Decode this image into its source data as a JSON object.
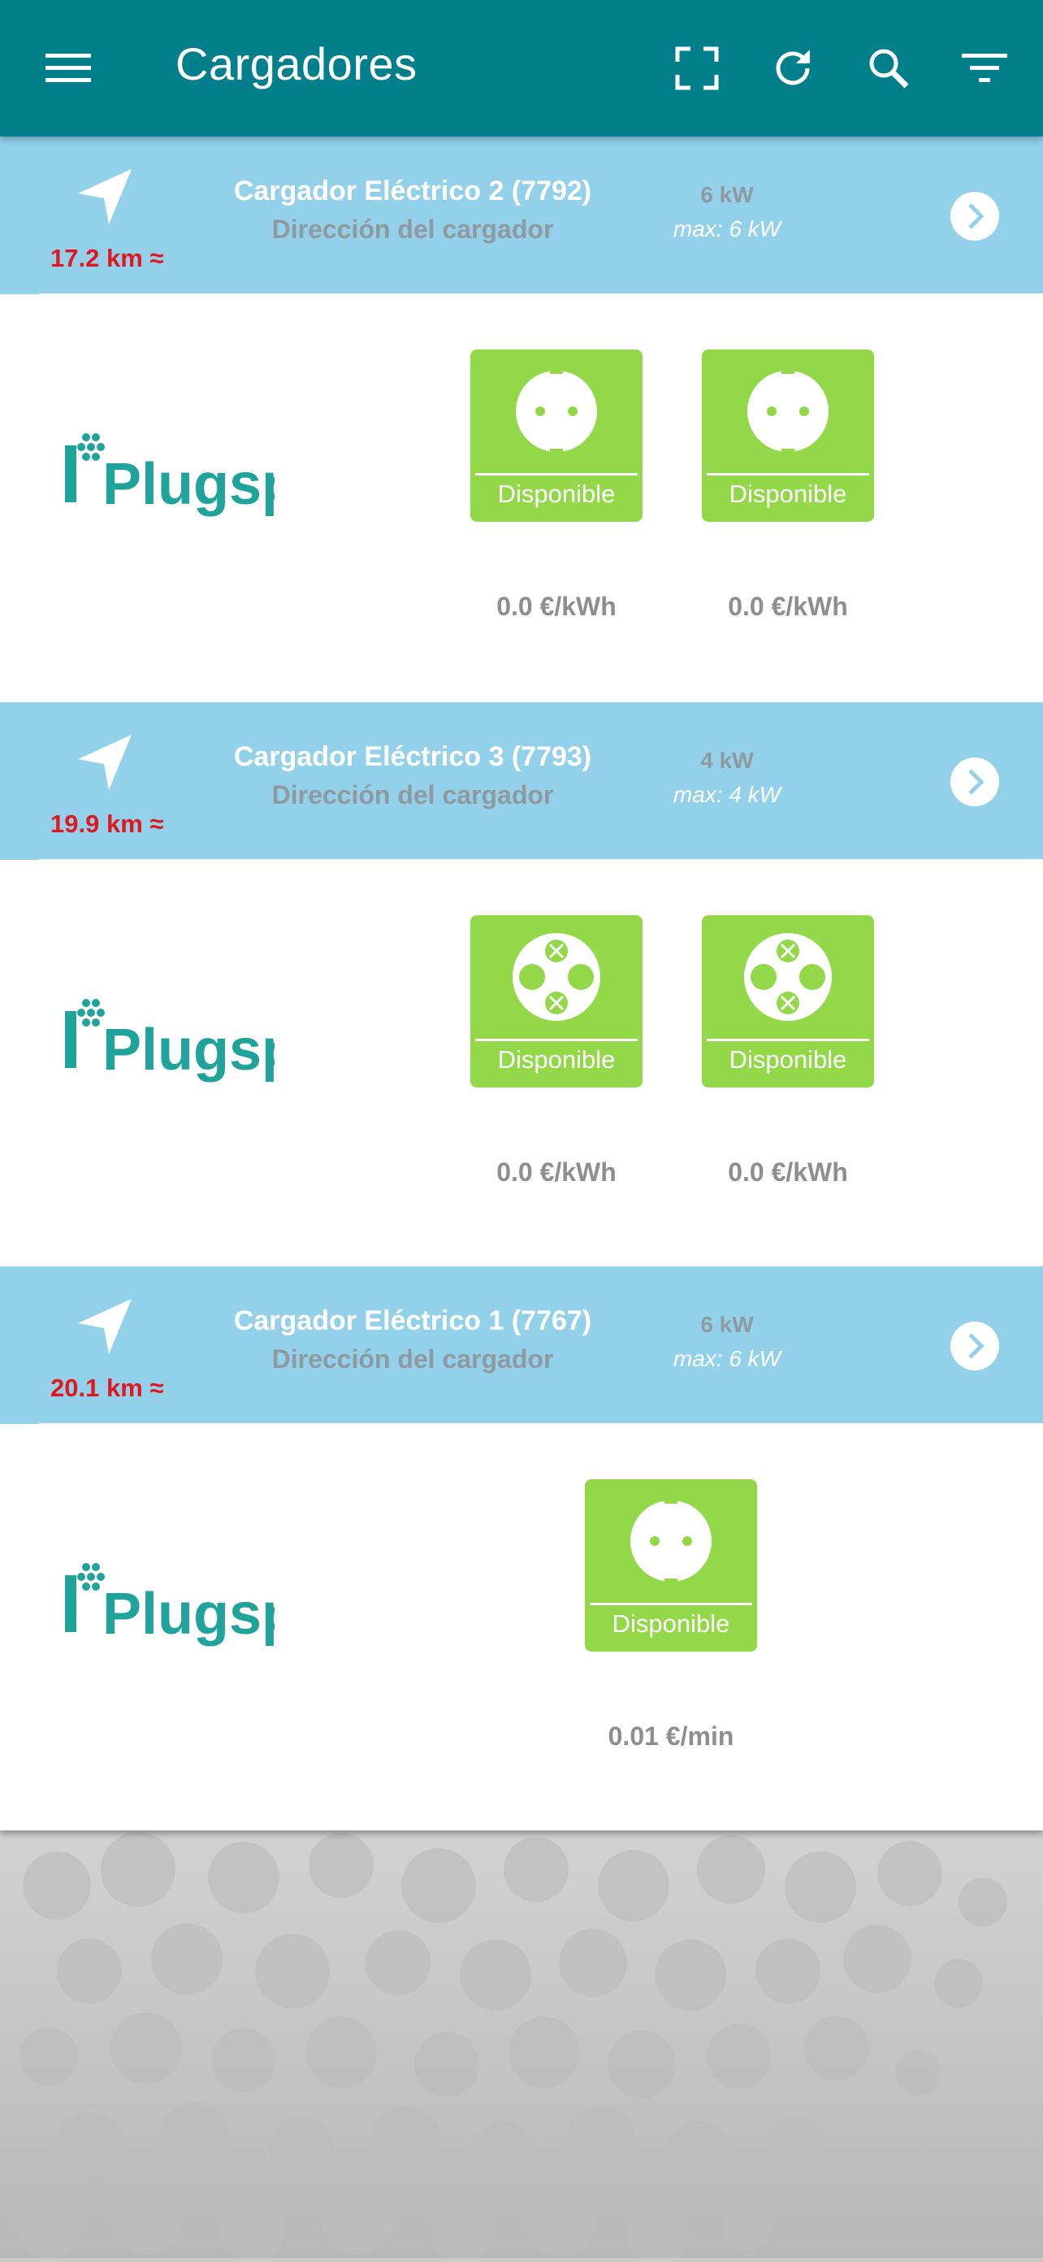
{
  "app_bar": {
    "title": "Cargadores",
    "icons": [
      "menu-icon",
      "fullscreen-icon",
      "refresh-icon",
      "search-icon",
      "filter-icon"
    ],
    "color": "#017f8a"
  },
  "chargers": [
    {
      "name": "Cargador Eléctrico 2 (7792)",
      "address": "Dirección del cargador",
      "distance": "17.2 km ≈",
      "power": "6 kW",
      "max_power": "max: 6 kW",
      "operator_logo": "Plugspot",
      "sockets": [
        {
          "type": "schuko",
          "status": "Disponible",
          "price": "0.0 €/kWh"
        },
        {
          "type": "schuko",
          "status": "Disponible",
          "price": "0.0 €/kWh"
        }
      ]
    },
    {
      "name": "Cargador Eléctrico 3 (7793)",
      "address": "Dirección del cargador",
      "distance": "19.9 km ≈",
      "power": "4 kW",
      "max_power": "max: 4 kW",
      "operator_logo": "Plugspot",
      "sockets": [
        {
          "type": "type2",
          "status": "Disponible",
          "price": "0.0 €/kWh"
        },
        {
          "type": "type2",
          "status": "Disponible",
          "price": "0.0 €/kWh"
        }
      ]
    },
    {
      "name": "Cargador Eléctrico 1 (7767)",
      "address": "Dirección del cargador",
      "distance": "20.1 km ≈",
      "power": "6 kW",
      "max_power": "max: 6 kW",
      "operator_logo": "Plugspot",
      "sockets": [
        {
          "type": "schuko",
          "status": "Disponible",
          "price": "0.01 €/min"
        }
      ]
    }
  ],
  "colors": {
    "header_bg": "#93d1ea",
    "socket_available": "#93d849",
    "distance_text": "#e0171f"
  }
}
